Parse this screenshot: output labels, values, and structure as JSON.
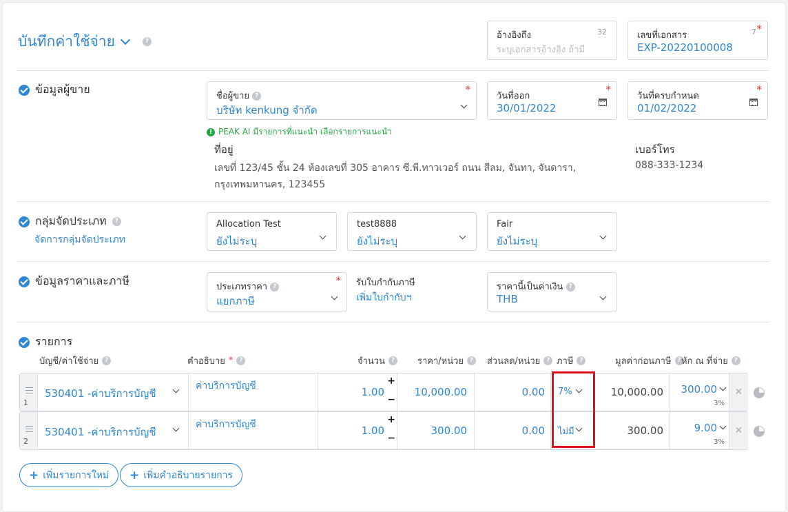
{
  "header": {
    "title": "บันทึกค่าใช้จ่าย"
  },
  "reference": {
    "label": "อ้างอิงถึง",
    "counter": "32",
    "placeholder": "ระบุเอกสารอ้างอิง ถ้ามี"
  },
  "doc_number": {
    "label": "เลขที่เอกสาร",
    "counter": "7",
    "value": "EXP-20220100008"
  },
  "vendor_section": {
    "title": "ข้อมูลผู้ขาย",
    "vendor": {
      "label": "ชื่อผู้ขาย",
      "value": "บริษัท kenkung จำกัด"
    },
    "issue_date": {
      "label": "วันที่ออก",
      "value": "30/01/2022"
    },
    "due_date": {
      "label": "วันที่ครบกำหนด",
      "value": "01/02/2022"
    },
    "ai_hint": "PEAK AI มีรายการที่แนะนำ เลือกรายการแนะนำ",
    "address_label": "ที่อยู่",
    "address_line1": "เลขที่ 123/45 ชั้น 24 ห้องเลขที่ 305 อาคาร ซี.พี.ทาวเวอร์ ถนน สีลม, จันทา, จันดารา,",
    "address_line2": "กรุงเทพมหานคร, 123455",
    "phone_label": "เบอร์โทร",
    "phone": "088-333-1234"
  },
  "group_section": {
    "title": "กลุ่มจัดประเภท",
    "manage_link": "จัดการกลุ่มจัดประเภท",
    "groups": [
      {
        "label": "Allocation Test",
        "value": "ยังไม่ระบุ"
      },
      {
        "label": "test8888",
        "value": "ยังไม่ระบุ"
      },
      {
        "label": "Fair",
        "value": "ยังไม่ระบุ"
      }
    ]
  },
  "price_section": {
    "title": "ข้อมูลราคาและภาษี",
    "price_type": {
      "label": "ประเภทราคา",
      "value": "แยกภาษี"
    },
    "tax_invoice": {
      "label": "รับใบกำกับภาษี",
      "link": "เพิ่มใบกำกับฯ"
    },
    "currency": {
      "label": "ราคานี้เป็นค่าเงิน",
      "value": "THB"
    }
  },
  "items_section": {
    "title": "รายการ",
    "columns": {
      "account": "บัญชี/ค่าใช้จ่าย",
      "description": "คำอธิบาย",
      "qty": "จำนวน",
      "price": "ราคา/หน่วย",
      "discount": "ส่วนลด/หน่วย",
      "vat": "ภาษี",
      "pretax": "มูลค่าก่อนภาษี",
      "wht": "หัก ณ ที่จ่าย"
    },
    "rows": [
      {
        "num": "1",
        "account": "530401 -ค่าบริการบัญชี",
        "description": "ค่าบริการบัญชี",
        "qty": "1.00",
        "price": "10,000.00",
        "discount": "0.00",
        "vat": "7%",
        "pretax": "10,000.00",
        "wht": "300.00",
        "wht_rate": "3%"
      },
      {
        "num": "2",
        "account": "530401 -ค่าบริการบัญชี",
        "description": "ค่าบริการบัญชี",
        "qty": "1.00",
        "price": "300.00",
        "discount": "0.00",
        "vat": "ไม่มี",
        "pretax": "300.00",
        "wht": "9.00",
        "wht_rate": "3%"
      }
    ],
    "add_item": "เพิ่มรายการใหม่",
    "add_description": "เพิ่มคำอธิบายรายการ"
  },
  "colors": {
    "accent": "#2f86d2",
    "required": "#e53935",
    "hint": "#28a745",
    "highlight": "#e0101a"
  }
}
